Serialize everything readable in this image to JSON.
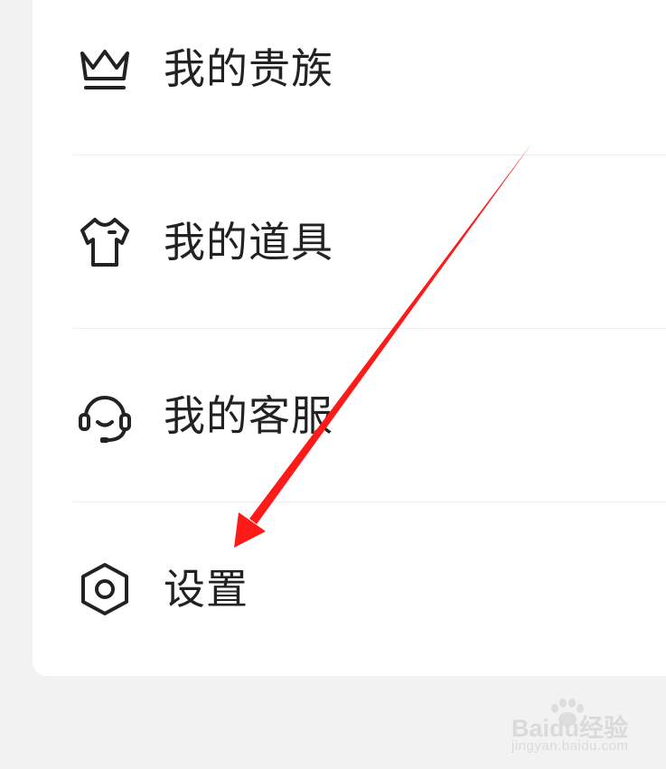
{
  "menu": {
    "items": [
      {
        "label": "我的贵族",
        "icon": "crown-icon"
      },
      {
        "label": "我的道具",
        "icon": "tshirt-icon"
      },
      {
        "label": "我的客服",
        "icon": "headset-icon"
      },
      {
        "label": "设置",
        "icon": "gear-icon"
      }
    ]
  },
  "annotation": {
    "arrow_color": "#ff1a1a"
  },
  "watermark": {
    "brand": "Baidu经验",
    "url": "jingyan.baidu.com"
  },
  "colors": {
    "background": "#f2f2f2",
    "card": "#ffffff",
    "text": "#222222",
    "icon": "#222222"
  }
}
